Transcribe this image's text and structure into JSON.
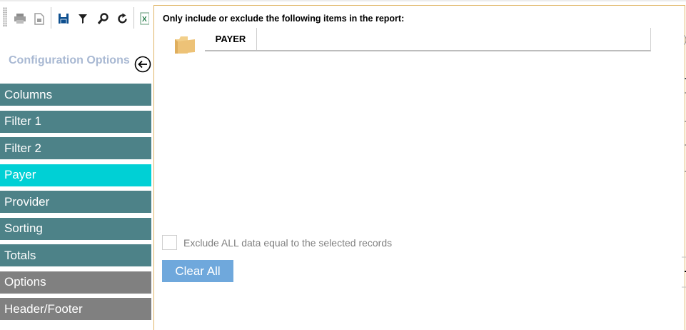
{
  "toolbar": {
    "icons": [
      "print-icon",
      "document-icon",
      "save-icon",
      "filter-icon",
      "search-icon",
      "refresh-icon",
      "excel-icon"
    ]
  },
  "config": {
    "title": "Configuration Options",
    "back_icon": "arrow-left-circle-icon"
  },
  "menu": {
    "items": [
      {
        "label": "Columns",
        "state": "normal"
      },
      {
        "label": "Filter 1",
        "state": "normal"
      },
      {
        "label": "Filter 2",
        "state": "normal"
      },
      {
        "label": "Payer",
        "state": "active"
      },
      {
        "label": "Provider",
        "state": "normal"
      },
      {
        "label": "Sorting",
        "state": "normal"
      },
      {
        "label": "Totals",
        "state": "normal"
      },
      {
        "label": "Options",
        "state": "secondary"
      },
      {
        "label": "Header/Footer",
        "state": "secondary"
      }
    ]
  },
  "panel": {
    "title": "Only include or exclude the following items in the report:",
    "grid_column": "PAYER",
    "exclude_label": "Exclude ALL data equal to the selected records",
    "exclude_checked": false,
    "clear_label": "Clear All"
  },
  "colors": {
    "menu_teal": "#4d8288",
    "menu_active": "#00d0d5",
    "menu_gray": "#808080",
    "panel_border": "#e0b565",
    "button_blue": "#6fa8dc"
  }
}
